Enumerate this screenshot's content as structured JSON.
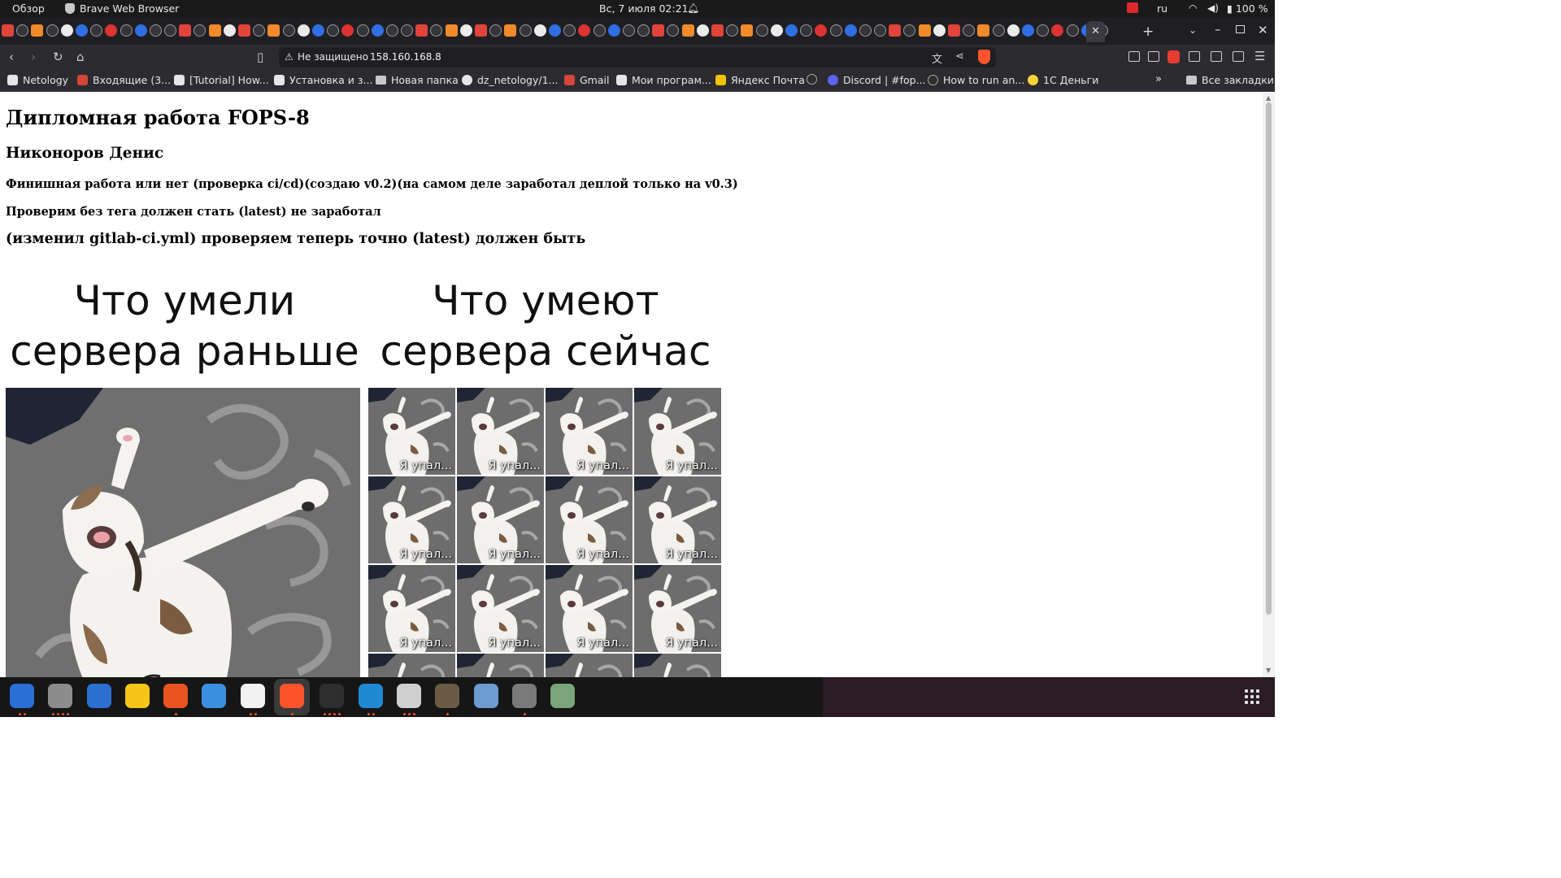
{
  "system_bar": {
    "activities": "Обзор",
    "app_name": "Brave Web Browser",
    "clock": "Вс, 7 июля  02:21",
    "language": "ru",
    "battery": "100 %"
  },
  "tabs": {
    "favicon_count": 75,
    "active_tab_close": "✕",
    "new_tab": "+"
  },
  "toolbar": {
    "security_label": "Не защищено",
    "url": "158.160.168.8"
  },
  "bookmarks": [
    {
      "label": "Netology",
      "icon": "netology-icon"
    },
    {
      "label": "Входящие (3...",
      "icon": "gmail-icon"
    },
    {
      "label": "[Tutorial] How...",
      "icon": "tutorial-icon"
    },
    {
      "label": "Установка и з...",
      "icon": "install-icon"
    },
    {
      "label": "Новая папка",
      "icon": "folder-icon"
    },
    {
      "label": "dz_netology/1...",
      "icon": "github-icon"
    },
    {
      "label": "Gmail",
      "icon": "gmail-icon"
    },
    {
      "label": "Мои програм...",
      "icon": "programs-icon"
    },
    {
      "label": "Яндекс Почта",
      "icon": "yandex-mail-icon"
    },
    {
      "label": "",
      "icon": "globe-icon"
    },
    {
      "label": "Discord | #fop...",
      "icon": "discord-icon"
    },
    {
      "label": "How to run an...",
      "icon": "medium-icon"
    },
    {
      "label": "1С Деньги",
      "icon": "1c-icon"
    }
  ],
  "all_bookmarks": "Все закладки",
  "page": {
    "title": "Дипломная работа FOPS-8",
    "author": "Никоноров Денис",
    "line1": "Финишная работа или нет (проверка ci/cd)(создаю v0.2)(на самом деле заработал деплой только на v0.3)",
    "line2": "Проверим без тега должен стать (latest) не заработал",
    "line3": "(изменил gitlab-ci.yml) проверяем теперь точно (latest) должен быть"
  },
  "meme": {
    "left_caption_1": "Что умели",
    "left_caption_2": "сервера раньше",
    "right_caption_1": "Что умеют",
    "right_caption_2": "сервера сейчас",
    "tile_caption": "Я упал...",
    "tile_count": 16
  },
  "dock": [
    {
      "name": "thunderbird",
      "color": "#2a6fd6"
    },
    {
      "name": "files",
      "color": "#8c8c8c"
    },
    {
      "name": "libreoffice-writer",
      "color": "#2b6fd0"
    },
    {
      "name": "rhythmbox",
      "color": "#f5c518"
    },
    {
      "name": "app-center",
      "color": "#e95420"
    },
    {
      "name": "help",
      "color": "#3b8fe0"
    },
    {
      "name": "text-editor",
      "color": "#f2f2f2"
    },
    {
      "name": "brave",
      "color": "#fb542b"
    },
    {
      "name": "terminal",
      "color": "#2e2e2e"
    },
    {
      "name": "vscode",
      "color": "#1f8ad2"
    },
    {
      "name": "image-viewer",
      "color": "#cfcfcf"
    },
    {
      "name": "gimp",
      "color": "#6b5a44"
    },
    {
      "name": "virtualbox",
      "color": "#6c9bd2"
    },
    {
      "name": "ssd-drive",
      "color": "#7a7a7a"
    },
    {
      "name": "trash",
      "color": "#7aa57a"
    }
  ],
  "colors": {
    "topbar": "#1a1a1a",
    "browser_chrome": "#2b2b30",
    "tabstrip": "#1f1f23",
    "brave_accent": "#fb542b",
    "ubuntu_accent": "#e95420"
  }
}
